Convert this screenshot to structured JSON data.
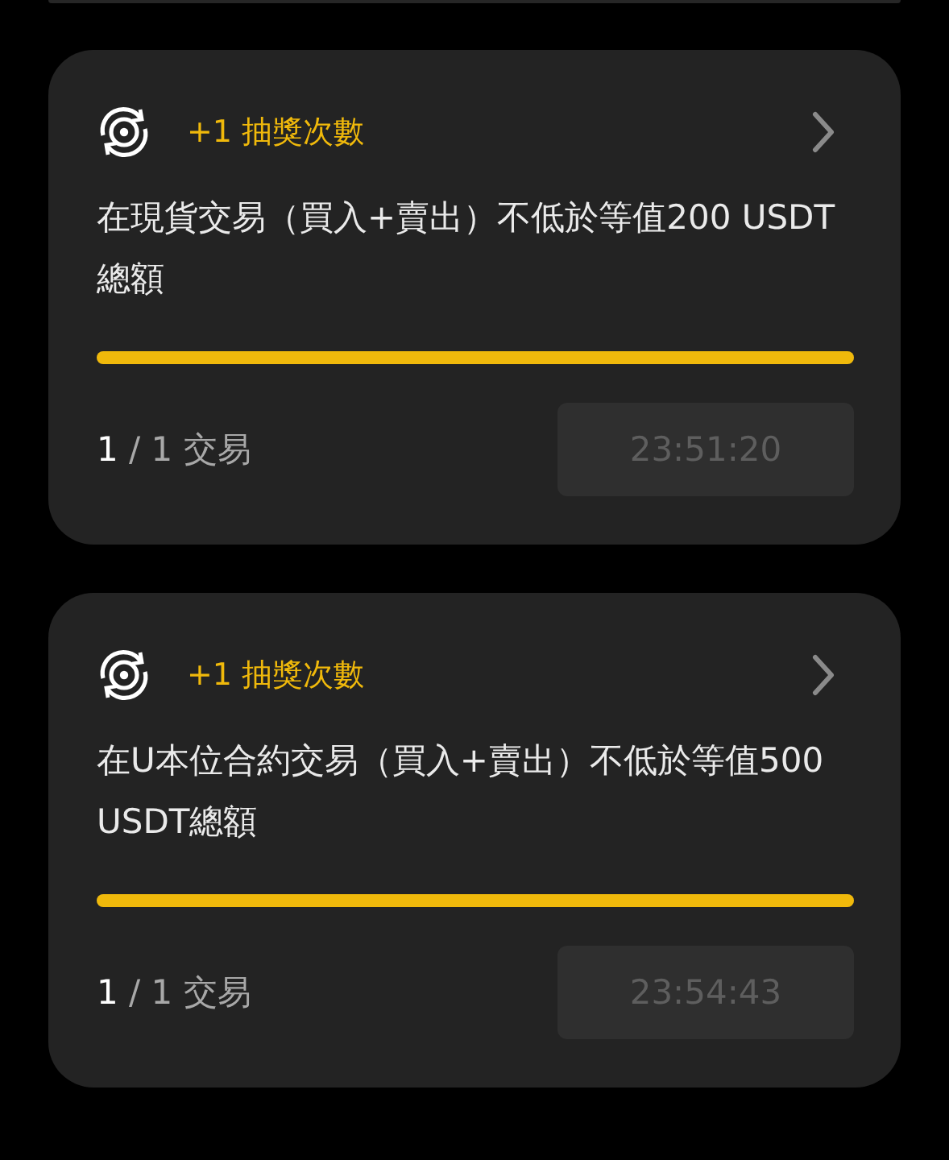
{
  "tasks": [
    {
      "reward": "+1 抽獎次數",
      "description": "在現貨交易（買入+賣出）不低於等值200 USDT總額",
      "level": 1,
      "progress": "**1** / 1 交易",
      "timer": "23:51:20",
      "timer_disabled": true
    },
    {
      "reward": "+1 抽獎次數",
      "description": "在U本位合約交易（買入+賣出）不低於等值500 USDT總額",
      "level": 1,
      "progress": "**1** / 1 交易",
      "timer": "23:54:43",
      "timer_disabled": true
    }
  ]
}
